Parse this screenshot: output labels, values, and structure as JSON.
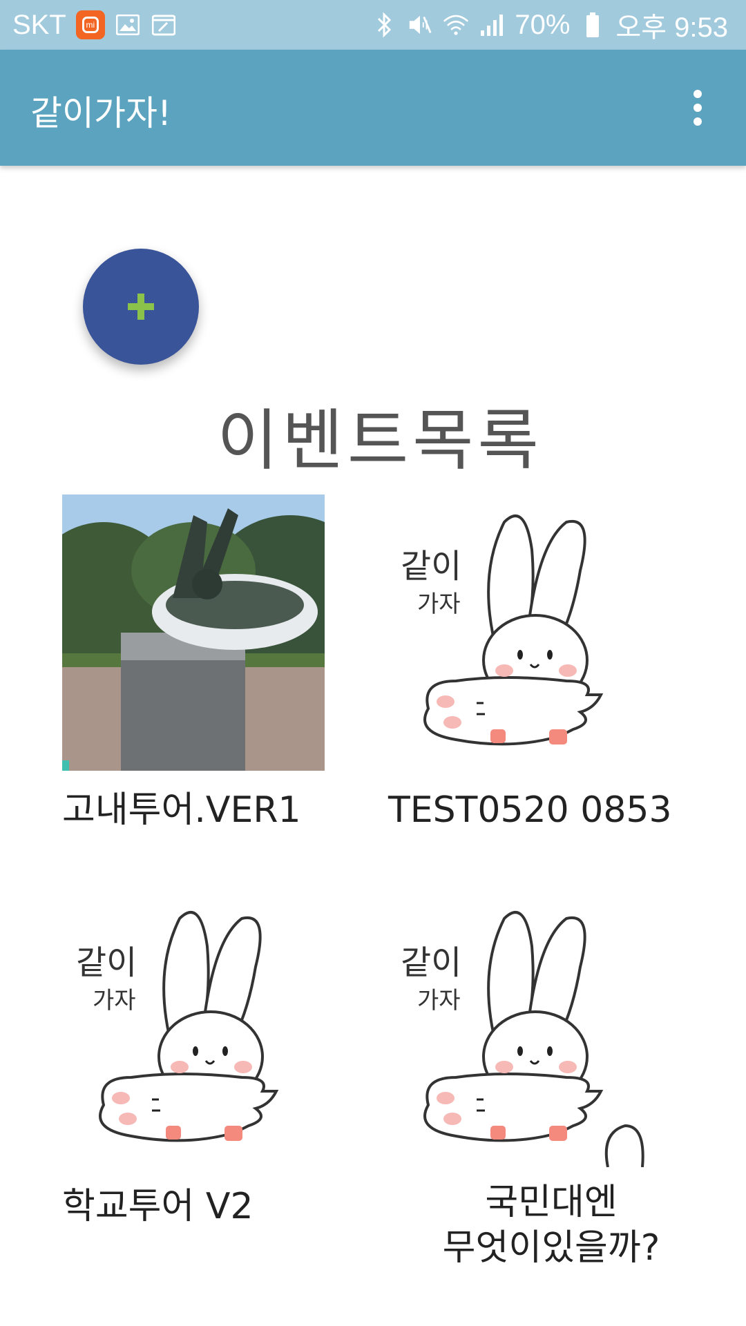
{
  "status_bar": {
    "carrier": "SKT",
    "battery": "70%",
    "time": "오후 9:53"
  },
  "app_bar": {
    "title": "같이가자!"
  },
  "section_title": "이벤트목록",
  "events": [
    {
      "title": "고내투어.VER1",
      "thumbnail": "photo-sculpture"
    },
    {
      "title": "TEST0520 0853",
      "thumbnail": "bunny-sticker"
    },
    {
      "title": "학교투어 V2",
      "thumbnail": "bunny-sticker"
    },
    {
      "title": "국민대엔\n무엇이있을까?",
      "thumbnail": "bunny-sticker"
    }
  ],
  "sticker_text": "같이\n가자",
  "colors": {
    "status_bar": "#a2cadd",
    "app_bar": "#5ba3bf",
    "fab": "#3a549a",
    "fab_icon": "#8bc34a"
  },
  "icons": [
    "bluetooth-icon",
    "mute-icon",
    "wifi-icon",
    "signal-icon",
    "battery-icon",
    "overflow-menu-icon",
    "add-icon"
  ]
}
